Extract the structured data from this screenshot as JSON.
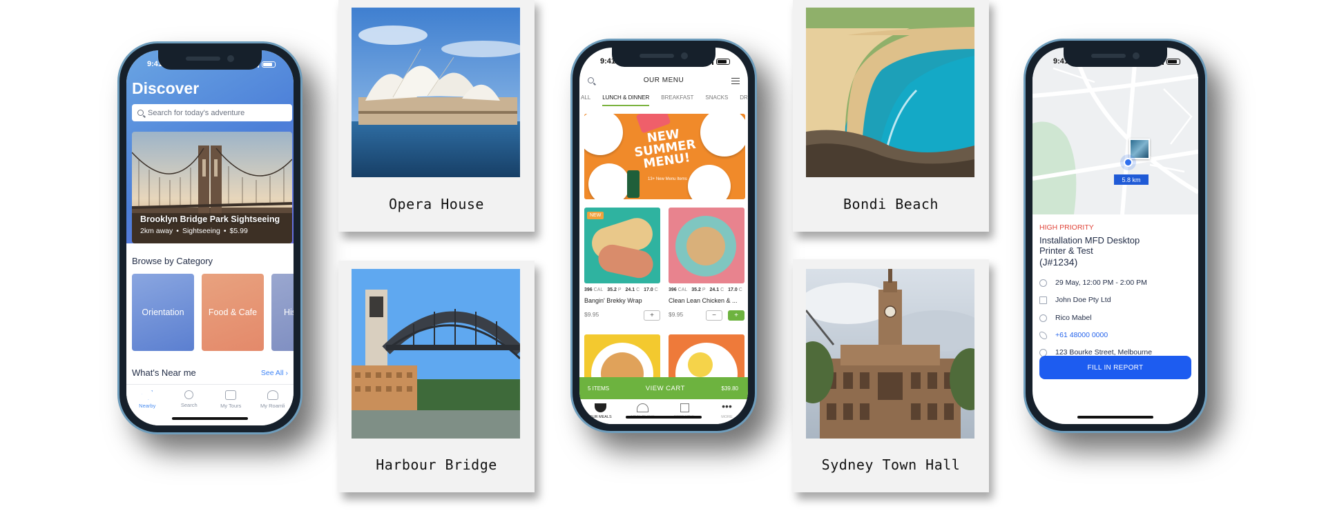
{
  "colors": {
    "accent_blue": "#4b8ef0",
    "menu_green": "#6db33f",
    "priority_red": "#e0453a",
    "report_blue": "#1d5cf0"
  },
  "phone_discover": {
    "time": "9:41",
    "title": "Discover",
    "search_placeholder": "Search for today's adventure",
    "featured": {
      "title": "Brooklyn Bridge Park Sightseeing",
      "distance": "2km away",
      "type": "Sightseeing",
      "price": "$5.99",
      "sep": "•"
    },
    "browse_title": "Browse by Category",
    "categories": [
      {
        "label": "Orientation",
        "color": "#5b7fd0"
      },
      {
        "label": "Food & Cafe",
        "color": "#e4896a"
      },
      {
        "label": "Hist",
        "color": "#7c8cc0"
      }
    ],
    "near_title": "What's Near me",
    "see_all": "See All",
    "tabs": [
      {
        "label": "Nearby",
        "icon": "navigation-icon"
      },
      {
        "label": "Search",
        "icon": "search-icon"
      },
      {
        "label": "My Tours",
        "icon": "map-icon"
      },
      {
        "label": "My Roamli",
        "icon": "user-icon"
      }
    ]
  },
  "polaroids": [
    {
      "caption": "Opera House"
    },
    {
      "caption": "Harbour Bridge"
    },
    {
      "caption": "Bondi Beach"
    },
    {
      "caption": "Sydney Town Hall"
    }
  ],
  "phone_menu": {
    "time": "9:41",
    "title": "OUR MENU",
    "tabs": [
      "ALL",
      "LUNCH & DINNER",
      "BREAKFAST",
      "SNACKS",
      "DRI"
    ],
    "active_tab": "LUNCH & DINNER",
    "banner": {
      "line1": "NEW",
      "line2": "SUMMER",
      "line3": "MENU!",
      "sub": "13+ New Menu Items"
    },
    "meals": [
      {
        "badge": "NEW",
        "cal": "396",
        "cal_u": "CAL",
        "p": "35.2",
        "p_u": "P",
        "c": "24.1",
        "c_u": "C",
        "f": "17.0",
        "f_u": "C",
        "name": "Bangin' Brekky Wrap",
        "price": "$9.95",
        "plus": "+"
      },
      {
        "cal": "396",
        "cal_u": "CAL",
        "p": "35.2",
        "p_u": "P",
        "c": "24.1",
        "c_u": "C",
        "f": "17.0",
        "f_u": "C",
        "name": "Clean Lean Chicken & ...",
        "price": "$9.95",
        "minus": "−",
        "plus": "+"
      }
    ],
    "cart": {
      "items": "5 ITEMS",
      "label": "VIEW CART",
      "total": "$39.80"
    },
    "bottom_tabs": [
      {
        "label": "OUR MEALS",
        "icon": "bowl-icon"
      },
      {
        "label": "MEAL PLANS",
        "icon": "cloche-icon"
      },
      {
        "label": "FREE MEAL",
        "icon": "gift-icon"
      },
      {
        "label": "MORE",
        "icon": "more-icon"
      }
    ]
  },
  "phone_job": {
    "time": "9:41",
    "distance": "5.8 km",
    "priority": "HIGH PRIORITY",
    "title_line1": "Installation MFD Desktop",
    "title_line2": "Printer & Test",
    "job_id": "(J#1234)",
    "details": [
      {
        "icon": "clock-icon",
        "text": "29 May, 12:00 PM - 2:00 PM"
      },
      {
        "icon": "building-icon",
        "text": "John Doe Pty Ltd"
      },
      {
        "icon": "user-icon",
        "text": "Rico Mabel"
      },
      {
        "icon": "phone-icon",
        "text": "+61 48000 0000"
      },
      {
        "icon": "pin-icon",
        "text": "123 Bourke Street, Melbourne"
      }
    ],
    "button": "FILL IN REPORT"
  }
}
